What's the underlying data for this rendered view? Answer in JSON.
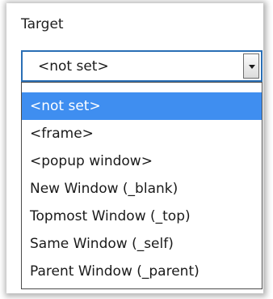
{
  "field_label": "Target",
  "select": {
    "value": "<not set>",
    "options": [
      "<not set>",
      "<frame>",
      "<popup window>",
      "New Window (_blank)",
      "Topmost Window (_top)",
      "Same Window (_self)",
      "Parent Window (_parent)"
    ],
    "selected_index": 0
  },
  "colors": {
    "highlight": "#3f8ef0",
    "focus_border": "#2a6fb5"
  },
  "icons": {
    "dropdown": "chevron-down-icon"
  }
}
